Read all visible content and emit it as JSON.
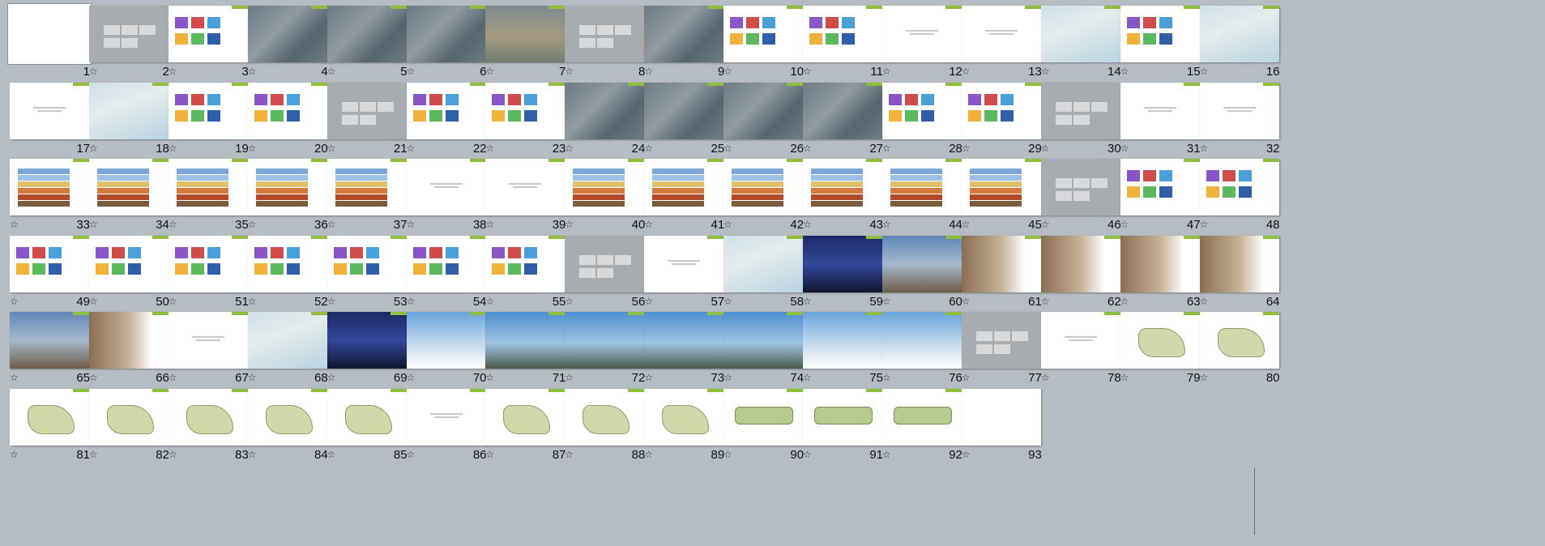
{
  "window": {
    "view": "slide-sorter"
  },
  "slides": [
    {
      "number": "1",
      "star": false,
      "style": "blank",
      "selected": true
    },
    {
      "number": "2",
      "star": true,
      "style": "gray"
    },
    {
      "number": "3",
      "star": true,
      "style": "colorful"
    },
    {
      "number": "4",
      "star": true,
      "style": "map"
    },
    {
      "number": "5",
      "star": true,
      "style": "map"
    },
    {
      "number": "6",
      "star": true,
      "style": "map"
    },
    {
      "number": "7",
      "star": true,
      "style": "aerial"
    },
    {
      "number": "8",
      "star": true,
      "style": "gray"
    },
    {
      "number": "9",
      "star": true,
      "style": "map"
    },
    {
      "number": "10",
      "star": true,
      "style": "colorful"
    },
    {
      "number": "11",
      "star": true,
      "style": "colorful"
    },
    {
      "number": "12",
      "star": true,
      "style": "text"
    },
    {
      "number": "13",
      "star": true,
      "style": "text"
    },
    {
      "number": "14",
      "star": true,
      "style": "sea"
    },
    {
      "number": "15",
      "star": true,
      "style": "colorful"
    },
    {
      "number": "16",
      "star": true,
      "style": "sea"
    },
    {
      "number": "17",
      "star": false,
      "style": "text"
    },
    {
      "number": "18",
      "star": true,
      "style": "sea"
    },
    {
      "number": "19",
      "star": true,
      "style": "colorful"
    },
    {
      "number": "20",
      "star": true,
      "style": "colorful"
    },
    {
      "number": "21",
      "star": true,
      "style": "gray"
    },
    {
      "number": "22",
      "star": true,
      "style": "colorful"
    },
    {
      "number": "23",
      "star": true,
      "style": "colorful"
    },
    {
      "number": "24",
      "star": true,
      "style": "map"
    },
    {
      "number": "25",
      "star": true,
      "style": "map"
    },
    {
      "number": "26",
      "star": true,
      "style": "map"
    },
    {
      "number": "27",
      "star": true,
      "style": "map"
    },
    {
      "number": "28",
      "star": true,
      "style": "colorful"
    },
    {
      "number": "29",
      "star": true,
      "style": "colorful"
    },
    {
      "number": "30",
      "star": true,
      "style": "gray"
    },
    {
      "number": "31",
      "star": true,
      "style": "text"
    },
    {
      "number": "32",
      "star": true,
      "style": "text"
    },
    {
      "number": "33",
      "star": true,
      "style": "diagram"
    },
    {
      "number": "34",
      "star": true,
      "style": "diagram"
    },
    {
      "number": "35",
      "star": true,
      "style": "diagram"
    },
    {
      "number": "36",
      "star": true,
      "style": "diagram"
    },
    {
      "number": "37",
      "star": true,
      "style": "diagram"
    },
    {
      "number": "38",
      "star": true,
      "style": "text"
    },
    {
      "number": "39",
      "star": true,
      "style": "text"
    },
    {
      "number": "40",
      "star": true,
      "style": "diagram"
    },
    {
      "number": "41",
      "star": true,
      "style": "diagram"
    },
    {
      "number": "42",
      "star": true,
      "style": "diagram"
    },
    {
      "number": "43",
      "star": true,
      "style": "diagram"
    },
    {
      "number": "44",
      "star": true,
      "style": "diagram"
    },
    {
      "number": "45",
      "star": true,
      "style": "diagram"
    },
    {
      "number": "46",
      "star": true,
      "style": "gray"
    },
    {
      "number": "47",
      "star": true,
      "style": "colorful"
    },
    {
      "number": "48",
      "star": true,
      "style": "colorful"
    },
    {
      "number": "49",
      "star": true,
      "style": "colorful"
    },
    {
      "number": "50",
      "star": true,
      "style": "colorful"
    },
    {
      "number": "51",
      "star": true,
      "style": "colorful"
    },
    {
      "number": "52",
      "star": true,
      "style": "colorful"
    },
    {
      "number": "53",
      "star": true,
      "style": "colorful"
    },
    {
      "number": "54",
      "star": true,
      "style": "colorful"
    },
    {
      "number": "55",
      "star": true,
      "style": "colorful"
    },
    {
      "number": "56",
      "star": true,
      "style": "gray"
    },
    {
      "number": "57",
      "star": true,
      "style": "text"
    },
    {
      "number": "58",
      "star": true,
      "style": "sea"
    },
    {
      "number": "59",
      "star": true,
      "style": "night"
    },
    {
      "number": "60",
      "star": true,
      "style": "dusk"
    },
    {
      "number": "61",
      "star": true,
      "style": "tower"
    },
    {
      "number": "62",
      "star": true,
      "style": "tower"
    },
    {
      "number": "63",
      "star": true,
      "style": "tower"
    },
    {
      "number": "64",
      "star": true,
      "style": "tower"
    },
    {
      "number": "65",
      "star": true,
      "style": "dusk"
    },
    {
      "number": "66",
      "star": true,
      "style": "tower"
    },
    {
      "number": "67",
      "star": true,
      "style": "text"
    },
    {
      "number": "68",
      "star": true,
      "style": "sea"
    },
    {
      "number": "69",
      "star": true,
      "style": "night"
    },
    {
      "number": "70",
      "star": true,
      "style": "glass2"
    },
    {
      "number": "71",
      "star": true,
      "style": "glass"
    },
    {
      "number": "72",
      "star": true,
      "style": "glass"
    },
    {
      "number": "73",
      "star": true,
      "style": "glass"
    },
    {
      "number": "74",
      "star": true,
      "style": "glass"
    },
    {
      "number": "75",
      "star": true,
      "style": "glass2"
    },
    {
      "number": "76",
      "star": true,
      "style": "glass2"
    },
    {
      "number": "77",
      "star": true,
      "style": "gray"
    },
    {
      "number": "78",
      "star": true,
      "style": "text"
    },
    {
      "number": "79",
      "star": true,
      "style": "plan"
    },
    {
      "number": "80",
      "star": true,
      "style": "plan"
    },
    {
      "number": "81",
      "star": true,
      "style": "plan"
    },
    {
      "number": "82",
      "star": true,
      "style": "plan"
    },
    {
      "number": "83",
      "star": true,
      "style": "plan"
    },
    {
      "number": "84",
      "star": true,
      "style": "plan"
    },
    {
      "number": "85",
      "star": true,
      "style": "plan"
    },
    {
      "number": "86",
      "star": true,
      "style": "text"
    },
    {
      "number": "87",
      "star": true,
      "style": "plan"
    },
    {
      "number": "88",
      "star": true,
      "style": "plan"
    },
    {
      "number": "89",
      "star": true,
      "style": "plan"
    },
    {
      "number": "90",
      "star": true,
      "style": "strip"
    },
    {
      "number": "91",
      "star": true,
      "style": "strip"
    },
    {
      "number": "92",
      "star": true,
      "style": "strip"
    },
    {
      "number": "93",
      "star": true,
      "style": "blank"
    }
  ],
  "star_glyph": "☆",
  "colors": {
    "background": "#b6bcc3",
    "accent_green": "#8fbf3a"
  }
}
